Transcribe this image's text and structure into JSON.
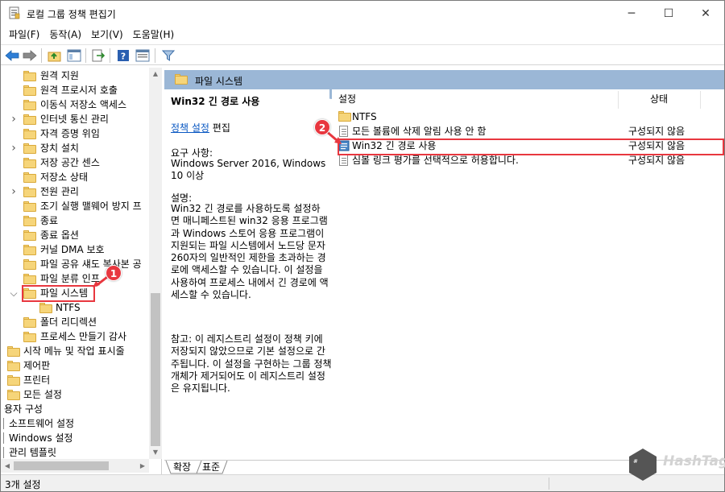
{
  "window": {
    "title": "로컬 그룹 정책 편집기",
    "controls": [
      "─",
      "☐",
      "✕"
    ]
  },
  "menu": [
    "파일(F)",
    "동작(A)",
    "보기(V)",
    "도움말(H)"
  ],
  "toolbar": {
    "buttons": [
      "back-arrow-icon",
      "forward-arrow-icon",
      "up-folder-icon",
      "show-hide-tree-icon",
      "export-list-icon",
      "help-icon",
      "properties-icon",
      "filter-icon"
    ]
  },
  "tree": {
    "items": [
      {
        "label": "원격 지원",
        "indent": 1,
        "chevron": ""
      },
      {
        "label": "원격 프로시저 호출",
        "indent": 1,
        "chevron": ""
      },
      {
        "label": "이동식 저장소 액세스",
        "indent": 1,
        "chevron": ""
      },
      {
        "label": "인터넷 통신 관리",
        "indent": 1,
        "chevron": ">"
      },
      {
        "label": "자격 증명 위임",
        "indent": 1,
        "chevron": ""
      },
      {
        "label": "장치 설치",
        "indent": 1,
        "chevron": ">"
      },
      {
        "label": "저장 공간 센스",
        "indent": 1,
        "chevron": ""
      },
      {
        "label": "저장소 상태",
        "indent": 1,
        "chevron": ""
      },
      {
        "label": "전원 관리",
        "indent": 1,
        "chevron": ">"
      },
      {
        "label": "조기 실행 맬웨어 방지 프",
        "indent": 1,
        "chevron": ""
      },
      {
        "label": "종료",
        "indent": 1,
        "chevron": ""
      },
      {
        "label": "종료 옵션",
        "indent": 1,
        "chevron": ""
      },
      {
        "label": "커널 DMA 보호",
        "indent": 1,
        "chevron": ""
      },
      {
        "label": "파일 공유 섀도 복사본 공",
        "indent": 1,
        "chevron": ""
      },
      {
        "label": "파일 분류 인프",
        "indent": 1,
        "chevron": ""
      },
      {
        "label": "파일 시스템",
        "indent": 1,
        "chevron": "v"
      },
      {
        "label": "NTFS",
        "indent": 2,
        "chevron": ""
      },
      {
        "label": "폴더 리디렉션",
        "indent": 1,
        "chevron": ""
      },
      {
        "label": "프로세스 만들기 감사",
        "indent": 1,
        "chevron": ""
      },
      {
        "label": "시작 메뉴 및 작업 표시줄",
        "indent": 0,
        "chevron": ""
      },
      {
        "label": "제어판",
        "indent": 0,
        "chevron": ""
      },
      {
        "label": "프린터",
        "indent": 0,
        "chevron": ""
      },
      {
        "label": "모든 설정",
        "indent": 0,
        "chevron": ""
      },
      {
        "label": "용자 구성",
        "indent": -1,
        "chevron": ""
      },
      {
        "label": "소프트웨어 설정",
        "indent": -2,
        "chevron": ""
      },
      {
        "label": "Windows 설정",
        "indent": -2,
        "chevron": ""
      },
      {
        "label": "관리 템플릿",
        "indent": -2,
        "chevron": ""
      }
    ]
  },
  "right": {
    "header": "파일 시스템",
    "description": {
      "heading": "Win32 긴 경로 사용",
      "edit_link": "정책 설정",
      "edit_suffix": " 편집",
      "req_label": "요구 사항:",
      "req_value": "Windows Server 2016, Windows 10 이상",
      "desc_label": "설명:",
      "desc_body": "Win32 긴 경로를 사용하도록 설정하면 매니페스트된 win32 응용 프로그램과 Windows 스토어 응용 프로그램이 지원되는 파일 시스템에서 노드당 문자 260자의 일반적인 제한을 초과하는 경로에 액세스할 수 있습니다. 이 설정을 사용하여 프로세스 내에서 긴 경로에 액세스할 수 있습니다.",
      "note": "참고: 이 레지스트리 설정이 정책 키에 저장되지 않았으므로 기본 설정으로 간주됩니다.  이 설정을 구현하는 그룹 정책 개체가 제거되어도 이 레지스트리 설정은 유지됩니다."
    },
    "columns": {
      "setting": "설정",
      "state": "상태"
    },
    "rows": [
      {
        "name": "NTFS",
        "state": "",
        "type": "folder"
      },
      {
        "name": "모든 볼륨에 삭제 알림 사용 안 함",
        "state": "구성되지 않음",
        "type": "policy"
      },
      {
        "name": "Win32 긴 경로 사용",
        "state": "구성되지 않음",
        "type": "policy-selected"
      },
      {
        "name": "심볼 링크 평가를 선택적으로 허용합니다.",
        "state": "구성되지 않음",
        "type": "policy"
      }
    ],
    "tabs": [
      "확장",
      "표준"
    ]
  },
  "status": {
    "text": "3개 설정"
  },
  "annotations": {
    "badge1": "1",
    "badge2": "2"
  },
  "watermark": {
    "text": "HashTag"
  },
  "colors": {
    "header_band": "#9bb7d6",
    "highlight": "#e8373f",
    "folder": "#f6d57a",
    "link": "#0a58c2"
  }
}
